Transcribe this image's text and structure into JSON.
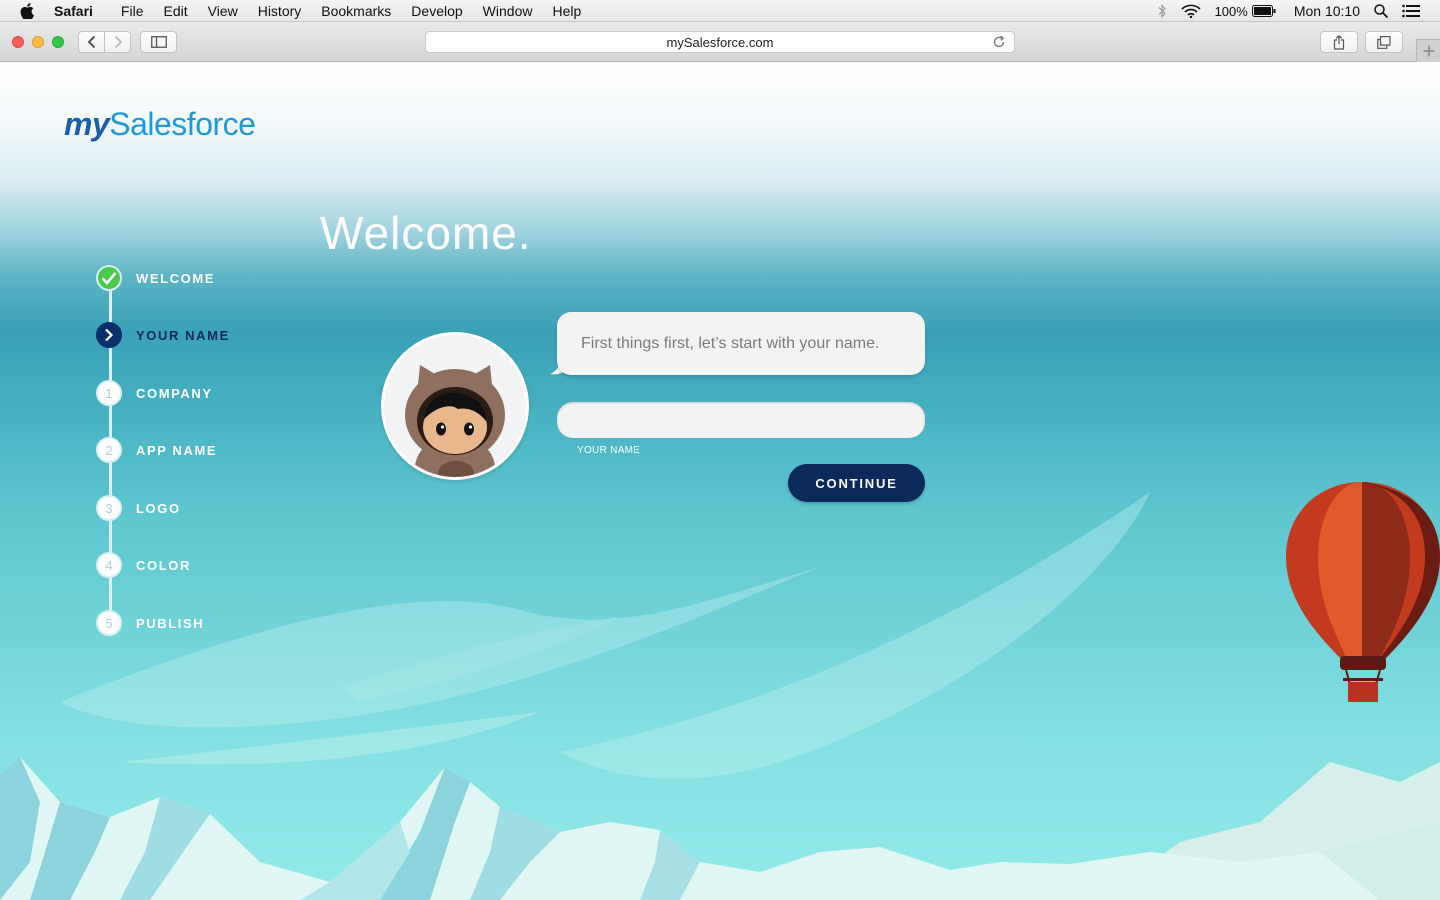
{
  "menubar": {
    "app_name": "Safari",
    "items": [
      "File",
      "Edit",
      "View",
      "History",
      "Bookmarks",
      "Develop",
      "Window",
      "Help"
    ],
    "battery": "100%",
    "clock": "Mon 10:10"
  },
  "browser": {
    "url": "mySalesforce.com"
  },
  "logo": {
    "my": "my",
    "brand": "Salesforce"
  },
  "page": {
    "title": "Welcome."
  },
  "steps": [
    {
      "label": "WELCOME",
      "marker": "",
      "state": "done"
    },
    {
      "label": "YOUR NAME",
      "marker": "",
      "state": "current"
    },
    {
      "label": "COMPANY",
      "marker": "1",
      "state": "todo"
    },
    {
      "label": "APP NAME",
      "marker": "2",
      "state": "todo"
    },
    {
      "label": "LOGO",
      "marker": "3",
      "state": "todo"
    },
    {
      "label": "COLOR",
      "marker": "4",
      "state": "todo"
    },
    {
      "label": "PUBLISH",
      "marker": "5",
      "state": "todo"
    }
  ],
  "prompt": {
    "bubble_text": "First things first, let’s start with your name.",
    "input_value": "",
    "input_label": "YOUR NAME",
    "continue_label": "CONTINUE"
  },
  "colors": {
    "brand_dark": "#0b2a59",
    "brand_blue": "#1b9ad7",
    "check_green": "#4bca4b"
  }
}
